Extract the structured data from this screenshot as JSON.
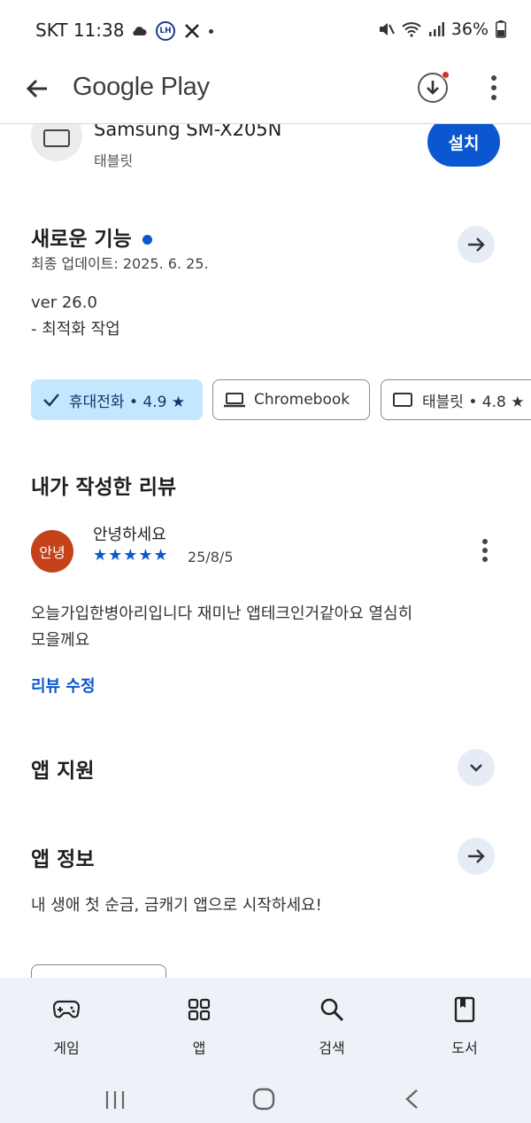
{
  "status_bar": {
    "time": "SKT 11:38",
    "lh_badge": "LH",
    "battery": "36%"
  },
  "app_bar": {
    "brand": "Google Play",
    "icons": [
      "back-arrow-icon",
      "download-icon",
      "more-vert-icon"
    ]
  },
  "device": {
    "name": "Samsung SM-X205N",
    "type": "태블릿",
    "install_label": "설치"
  },
  "whats_new": {
    "title": "새로운 기능",
    "updated": "최종 업데이트: 2025. 6. 25.",
    "version": "ver 26.0",
    "note": "- 최적화 작업"
  },
  "chips": [
    {
      "label": "휴대전화 • 4.9 ★",
      "selected": true,
      "icon": "check-icon"
    },
    {
      "label": "Chromebook",
      "selected": false,
      "icon": "laptop-icon"
    },
    {
      "label": "태블릿 • 4.8 ★",
      "selected": false,
      "icon": "tablet-icon"
    }
  ],
  "my_review": {
    "title": "내가 작성한 리뷰",
    "avatar_text": "안녕",
    "author": "안녕하세요",
    "stars": "★★★★★",
    "rating": 5,
    "date": "25/8/5",
    "text_line1": "오늘가입한병아리입니다 재미난 앱테크인거같아요 열심히",
    "text_line2": "모을께요",
    "edit_label": "리뷰 수정"
  },
  "app_support": {
    "title": "앱 지원"
  },
  "app_info": {
    "title": "앱 정보",
    "description": "내 생애 첫 순금, 금캐기 앱으로 시작하세요!"
  },
  "bottom_nav": {
    "items": [
      {
        "label": "게임",
        "icon": "gamepad-icon"
      },
      {
        "label": "앱",
        "icon": "apps-grid-icon"
      },
      {
        "label": "검색",
        "icon": "search-icon"
      },
      {
        "label": "도서",
        "icon": "book-icon"
      }
    ]
  },
  "colors": {
    "accent": "#0b57d0",
    "chip_selected": "#c2e7ff",
    "avatar": "#c5421b",
    "nav_bg": "#eef2f8"
  }
}
